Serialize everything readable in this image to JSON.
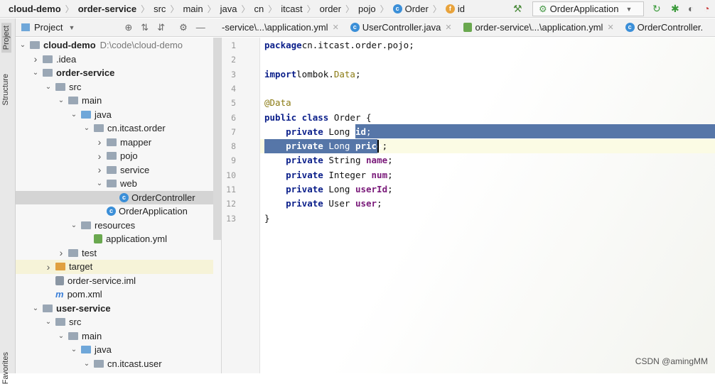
{
  "breadcrumb": [
    {
      "label": "cloud-demo",
      "bold": true
    },
    {
      "label": "order-service",
      "bold": true
    },
    {
      "label": "src"
    },
    {
      "label": "main"
    },
    {
      "label": "java"
    },
    {
      "label": "cn"
    },
    {
      "label": "itcast"
    },
    {
      "label": "order"
    },
    {
      "label": "pojo"
    },
    {
      "label": "Order",
      "icon": "c"
    },
    {
      "label": "id",
      "icon": "f"
    }
  ],
  "run_config": "OrderApplication",
  "side_tabs": {
    "project": "Project",
    "structure": "Structure",
    "favorites": "Favorites"
  },
  "project_panel": {
    "title": "Project"
  },
  "tree": [
    {
      "label": "cloud-demo",
      "extra": "D:\\code\\cloud-demo",
      "level": 0,
      "arrow": "down",
      "type": "module",
      "bold": true
    },
    {
      "label": ".idea",
      "level": 1,
      "arrow": "right",
      "type": "folder"
    },
    {
      "label": "order-service",
      "level": 1,
      "arrow": "down",
      "type": "module",
      "bold": true
    },
    {
      "label": "src",
      "level": 2,
      "arrow": "down",
      "type": "folder"
    },
    {
      "label": "main",
      "level": 3,
      "arrow": "down",
      "type": "folder"
    },
    {
      "label": "java",
      "level": 4,
      "arrow": "down",
      "type": "blue"
    },
    {
      "label": "cn.itcast.order",
      "level": 5,
      "arrow": "down",
      "type": "folder"
    },
    {
      "label": "mapper",
      "level": 6,
      "arrow": "right",
      "type": "folder"
    },
    {
      "label": "pojo",
      "level": 6,
      "arrow": "right",
      "type": "folder"
    },
    {
      "label": "service",
      "level": 6,
      "arrow": "right",
      "type": "folder"
    },
    {
      "label": "web",
      "level": 6,
      "arrow": "down",
      "type": "folder"
    },
    {
      "label": "OrderController",
      "level": 7,
      "type": "class",
      "selected": true
    },
    {
      "label": "OrderApplication",
      "level": 6,
      "type": "class"
    },
    {
      "label": "resources",
      "level": 4,
      "arrow": "down",
      "type": "folder"
    },
    {
      "label": "application.yml",
      "level": 5,
      "type": "yml"
    },
    {
      "label": "test",
      "level": 3,
      "arrow": "right",
      "type": "folder"
    },
    {
      "label": "target",
      "level": 2,
      "arrow": "right",
      "type": "target",
      "highlight": true
    },
    {
      "label": "order-service.iml",
      "level": 2,
      "type": "iml"
    },
    {
      "label": "pom.xml",
      "level": 2,
      "type": "maven"
    },
    {
      "label": "user-service",
      "level": 1,
      "arrow": "down",
      "type": "module",
      "bold": true
    },
    {
      "label": "src",
      "level": 2,
      "arrow": "down",
      "type": "folder"
    },
    {
      "label": "main",
      "level": 3,
      "arrow": "down",
      "type": "folder"
    },
    {
      "label": "java",
      "level": 4,
      "arrow": "down",
      "type": "blue"
    },
    {
      "label": "cn.itcast.user",
      "level": 5,
      "arrow": "down",
      "type": "folder"
    }
  ],
  "editor_tabs": [
    {
      "label": "-service\\...\\application.yml",
      "icon": ""
    },
    {
      "label": "UserController.java",
      "icon": "c"
    },
    {
      "label": "order-service\\...\\application.yml",
      "icon": "yml"
    },
    {
      "label": "OrderController.",
      "icon": "c"
    }
  ],
  "code": [
    [
      [
        "kw",
        "package"
      ],
      [
        "",
        "cn.itcast.order.pojo;"
      ]
    ],
    [],
    [
      [
        "kw",
        "import"
      ],
      [
        "",
        "lombok."
      ],
      [
        "an",
        "Data"
      ],
      [
        "",
        ";"
      ]
    ],
    [],
    [
      [
        "an",
        "@Data"
      ]
    ],
    [
      [
        "kw",
        "public class"
      ],
      [
        "",
        " Order {"
      ]
    ],
    [
      [
        "",
        "    "
      ],
      [
        "kw",
        "private"
      ],
      [
        "",
        " Long "
      ],
      [
        "fd",
        "id"
      ],
      [
        "",
        ";"
      ]
    ],
    [
      [
        "",
        "    "
      ],
      [
        "kw",
        "private"
      ],
      [
        "",
        " Long "
      ],
      [
        "fd",
        "price"
      ],
      [
        "",
        ";"
      ]
    ],
    [
      [
        "",
        "    "
      ],
      [
        "kw",
        "private"
      ],
      [
        "",
        " String "
      ],
      [
        "fd",
        "name"
      ],
      [
        "",
        ";"
      ]
    ],
    [
      [
        "",
        "    "
      ],
      [
        "kw",
        "private"
      ],
      [
        "",
        " Integer "
      ],
      [
        "fd",
        "num"
      ],
      [
        "",
        ";"
      ]
    ],
    [
      [
        "",
        "    "
      ],
      [
        "kw",
        "private"
      ],
      [
        "",
        " Long "
      ],
      [
        "fd",
        "userId"
      ],
      [
        "",
        ";"
      ]
    ],
    [
      [
        "",
        "    "
      ],
      [
        "kw",
        "private"
      ],
      [
        "",
        " User "
      ],
      [
        "fd",
        "user"
      ],
      [
        "",
        ";"
      ]
    ],
    [
      [
        "",
        "}"
      ]
    ]
  ],
  "line_numbers": [
    "1",
    "2",
    "3",
    "4",
    "5",
    "6",
    "7",
    "8",
    "9",
    "10",
    "11",
    "12",
    "13"
  ],
  "watermark": "CSDN @amingMM"
}
